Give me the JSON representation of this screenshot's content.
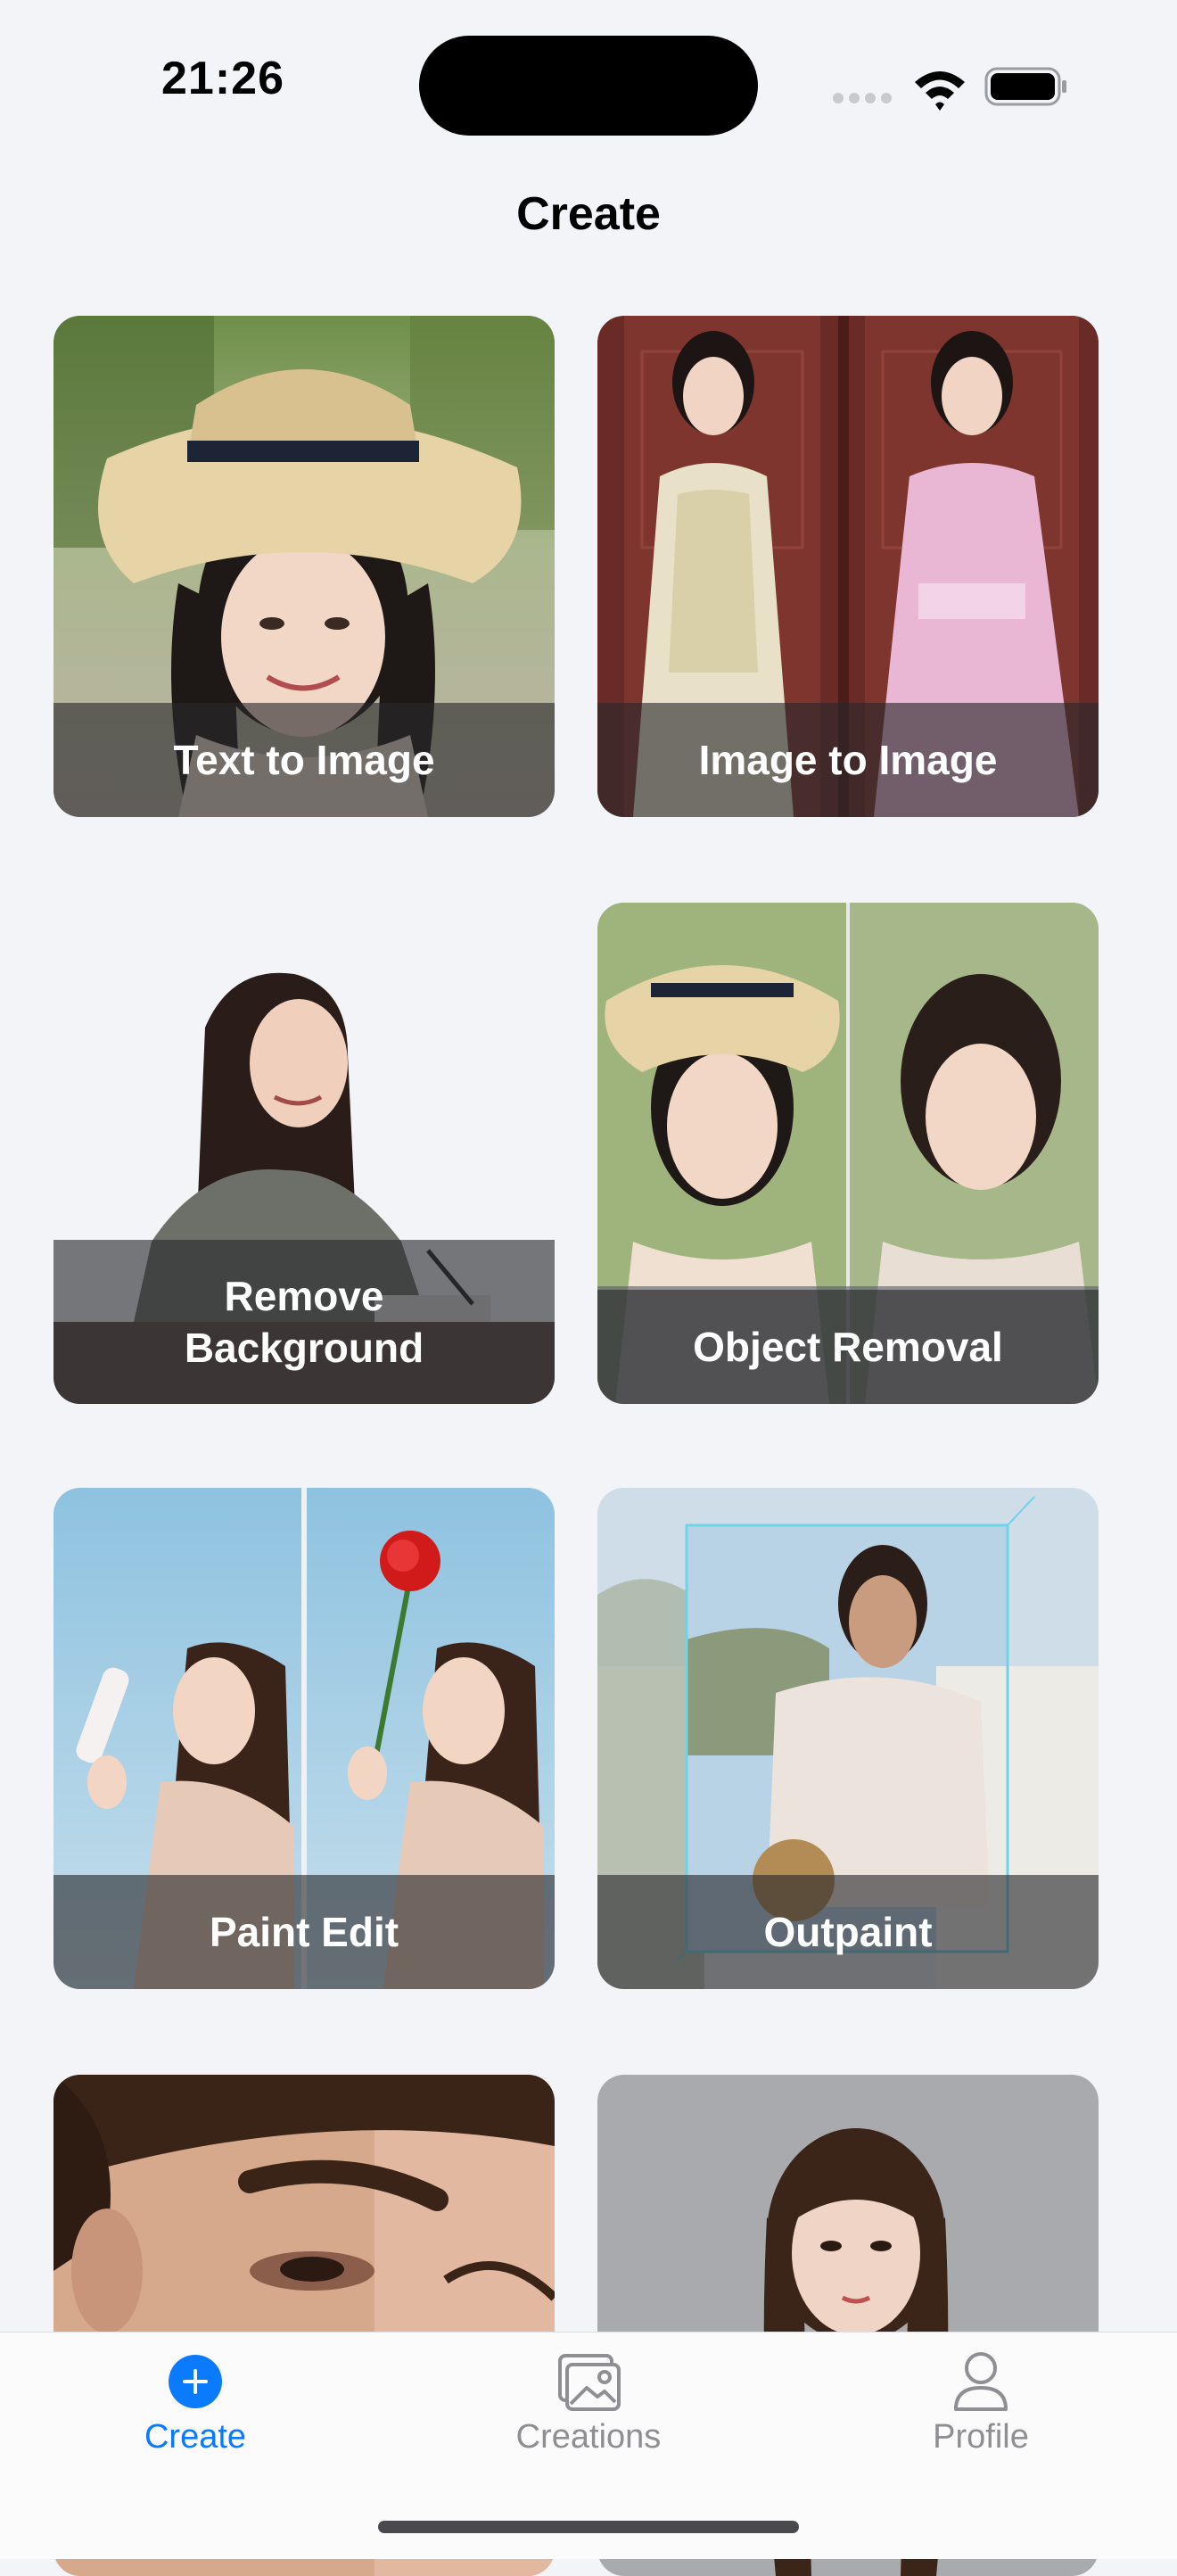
{
  "status_bar": {
    "time": "21:26",
    "icons": [
      "cellular-signal-icon",
      "wifi-icon",
      "battery-icon"
    ]
  },
  "title": "Create",
  "cards": [
    {
      "label": "Text to Image",
      "image": "girl-in-straw-hat-photo"
    },
    {
      "label": "Image to Image",
      "image": "girl-in-traditional-dress-comparison"
    },
    {
      "label": "Remove\nBackground",
      "image": "girl-writing-at-desk-cutout"
    },
    {
      "label": "Object Removal",
      "image": "girl-hat-removed-comparison"
    },
    {
      "label": "Paint Edit",
      "image": "girl-holding-rose-comparison"
    },
    {
      "label": "Outpaint",
      "image": "woman-in-lace-blouse-expanded"
    },
    {
      "label": "",
      "image": "close-up-face-eyebrow"
    },
    {
      "label": "",
      "image": "girl-portrait-grey-background"
    }
  ],
  "tab_bar": {
    "items": [
      {
        "label": "Create",
        "icon": "plus-circle-icon",
        "active": true
      },
      {
        "label": "Creations",
        "icon": "photo-gallery-icon",
        "active": false
      },
      {
        "label": "Profile",
        "icon": "person-icon",
        "active": false
      }
    ]
  },
  "colors": {
    "accent": "#0a7aff",
    "inactive": "#8e8e93",
    "background": "#f2f4f8",
    "card_overlay": "#28282c"
  }
}
